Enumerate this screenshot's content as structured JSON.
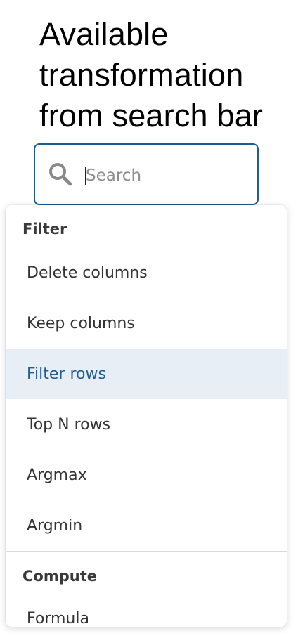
{
  "heading": "Available\ntransformation\nfrom search bar",
  "search": {
    "placeholder": "Search",
    "value": ""
  },
  "colors": {
    "accent": "#1f5b94",
    "highlight_bg": "#e8eef6"
  },
  "dropdown": {
    "groups": [
      {
        "label": "Filter",
        "items": [
          "Delete columns",
          "Keep columns",
          "Filter rows",
          "Top N rows",
          "Argmax",
          "Argmin"
        ]
      },
      {
        "label": "Compute",
        "items": [
          "Formula"
        ]
      }
    ],
    "highlighted_item": "Filter rows"
  }
}
